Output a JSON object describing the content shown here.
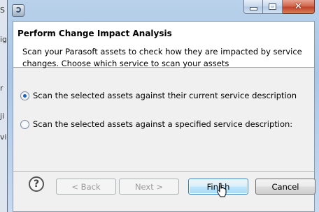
{
  "background": {
    "chars": [
      "S",
      "ig",
      "r",
      "ji",
      "vi"
    ]
  },
  "dialog": {
    "header": {
      "title": "Perform Change Impact Analysis",
      "description": "Scan your Parasoft assets to check how they are impacted by service changes.  Choose which service to scan your assets"
    },
    "options": [
      {
        "label": "Scan the selected assets against their current service description",
        "selected": true
      },
      {
        "label": "Scan the selected assets against a specified service description:",
        "selected": false
      }
    ],
    "buttons": {
      "help": "?",
      "back": "< Back",
      "next": "Next >",
      "finish": "Finish",
      "cancel": "Cancel"
    }
  },
  "titlebar": {
    "close_glyph": "✕"
  },
  "colors": {
    "accent": "#1f5fb5",
    "close_red": "#c1432a",
    "frame_blue": "#a9c6e6"
  }
}
